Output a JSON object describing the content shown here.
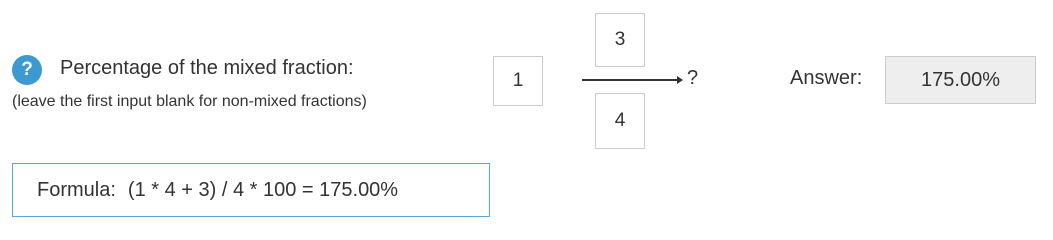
{
  "question": {
    "help_icon": "question-circle-icon",
    "help_glyph": "?",
    "label": "Percentage of the mixed fraction:",
    "hint": "(leave the first input blank for non-mixed fractions)"
  },
  "fraction": {
    "whole": "1",
    "numerator": "3",
    "denominator": "4",
    "question_mark": "?"
  },
  "answer": {
    "label": "Answer:",
    "value": "175.00%"
  },
  "formula": {
    "label": "Formula:",
    "expression": "(1 * 4 + 3) / 4 * 100 = 175.00%"
  },
  "colors": {
    "help_icon_bg": "#3d9ad1",
    "formula_border": "#5aa6de",
    "answer_bg": "#eeeeee",
    "text": "#333333"
  }
}
